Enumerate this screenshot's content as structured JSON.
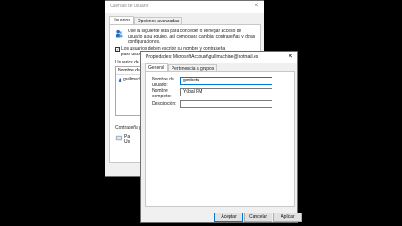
{
  "back_window": {
    "title": "Cuentas de usuario",
    "close_glyph": "✕",
    "tabs": [
      {
        "label": "Usuarios"
      },
      {
        "label": "Opciones avanzadas"
      }
    ],
    "info_text": "Use la siguiente lista para conceder o denegar acceso de usuario a su equipo, así como para cambiar contraseñas y otras configuraciones.",
    "checkbox_text": "Los usuarios deben escribir su nombre y contraseña para usar el equipo.",
    "checkbox_glyph": "✓",
    "list_label": "Usuarios de este equipo:",
    "list_header": "Nombre de u",
    "list_items": [
      {
        "label": "guillmachi"
      }
    ],
    "password_label": "Contraseña p",
    "password_lines": [
      "Pa",
      "Us"
    ]
  },
  "front_window": {
    "title": "Propiedades: MicrosoftAccount\\guillmachine@hotmail.es",
    "close_glyph": "✕",
    "tabs": [
      {
        "label": "General"
      },
      {
        "label": "Pertenencia a grupos"
      }
    ],
    "fields": {
      "username_label": "Nombre de usuario:",
      "username_value": "genbeta",
      "fullname_label": "Nombre completo:",
      "fullname_value": "Yúbal FM",
      "description_label": "Descripción:",
      "description_value": ""
    },
    "buttons": {
      "accept": "Aceptar",
      "cancel": "Cancelar",
      "apply": "Aplicar"
    }
  },
  "colors": {
    "background": "#000000",
    "dialog": "#f0f0f0",
    "accent": "#0078d7",
    "info_icon": "#1e6fc4"
  }
}
